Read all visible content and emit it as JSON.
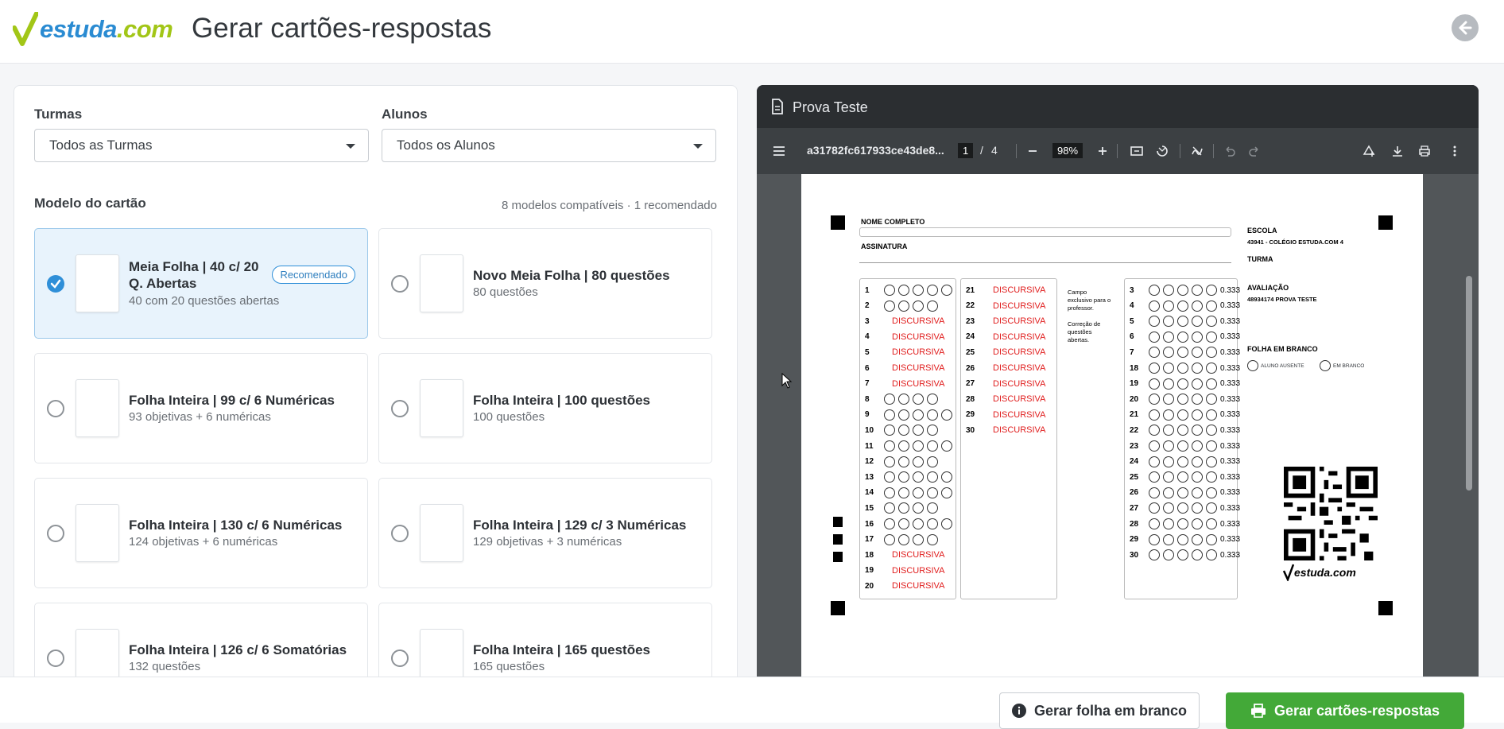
{
  "header": {
    "logo_text": "estuda",
    "logo_suffix": ".com",
    "title": "Gerar cartões-respostas"
  },
  "filters": {
    "turmas_label": "Turmas",
    "turmas_value": "Todos as Turmas",
    "alunos_label": "Alunos",
    "alunos_value": "Todos os Alunos"
  },
  "models": {
    "title": "Modelo do cartão",
    "meta": "8 modelos compatíveis · 1 recomendado",
    "badge": "Recomendado",
    "items": [
      {
        "name": "Meia Folha | 40 c/ 20",
        "name2": "Q. Abertas",
        "desc": "40 com 20 questões abertas",
        "selected": true
      },
      {
        "name": "Novo Meia Folha | 80 questões",
        "desc": "80 questões"
      },
      {
        "name": "Folha Inteira | 99 c/ 6 Numéricas",
        "desc": "93 objetivas + 6 numéricas"
      },
      {
        "name": "Folha Inteira | 100 questões",
        "desc": "100 questões"
      },
      {
        "name": "Folha Inteira | 130 c/ 6 Numéricas",
        "desc": "124 objetivas + 6 numéricas"
      },
      {
        "name": "Folha Inteira | 129 c/ 3 Numéricas",
        "desc": "129 objetivas + 3 numéricas"
      },
      {
        "name": "Folha Inteira | 126 c/ 6 Somatórias",
        "desc": "132 questões"
      },
      {
        "name": "Folha Inteira | 165 questões",
        "desc": "165 questões"
      }
    ]
  },
  "viewer": {
    "title": "Prova Teste",
    "filename": "a31782fc617933ce43de8...",
    "page_current": "1",
    "page_sep": "/",
    "page_total": "4",
    "zoom": "98%"
  },
  "sheet": {
    "nome_label": "NOME COMPLETO",
    "assinatura_label": "ASSINATURA",
    "escola_label": "ESCOLA",
    "escola_value": "43941 - COLÉGIO ESTUDA.COM 4",
    "turma_label": "TURMA",
    "avaliacao_label": "AVALIAÇÃO",
    "avaliacao_value": "48934174 PROVA TESTE",
    "folha_branco_label": "FOLHA EM BRANCO",
    "aluno_ausente": "ALUNO AUSENTE",
    "em_branco": "EM BRANCO",
    "campo_prof": "Campo exclusivo para o professor.",
    "correcao": "Correção de questões abertas.",
    "discursiva": "DISCURSIVA",
    "weight": "0.333",
    "logo": "estuda.com"
  },
  "footer": {
    "blank_button": "Gerar folha em branco",
    "generate_button": "Gerar cartões-respostas"
  },
  "colors": {
    "primary": "#2f8fd8",
    "green": "#43a938",
    "discursiva": "#e01c1c"
  }
}
